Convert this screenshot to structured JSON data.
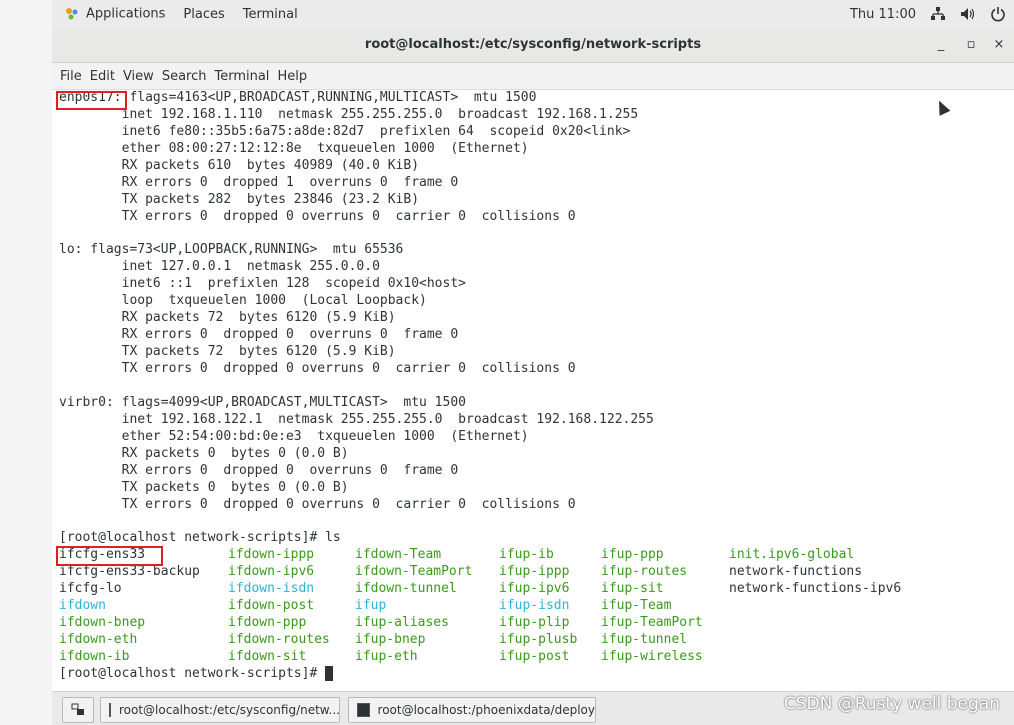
{
  "panel": {
    "applications": "Applications",
    "places": "Places",
    "terminal": "Terminal",
    "clock": "Thu 11:00",
    "icons": [
      "network-icon",
      "volume-icon",
      "power-icon"
    ]
  },
  "window": {
    "title": "root@localhost:/etc/sysconfig/network-scripts",
    "minimize": "_",
    "maximize": "▫",
    "close": "×"
  },
  "menu": [
    "File",
    "Edit",
    "View",
    "Search",
    "Terminal",
    "Help"
  ],
  "terminal_lines": [
    "enp0s17: flags=4163<UP,BROADCAST,RUNNING,MULTICAST>  mtu 1500",
    "        inet 192.168.1.110  netmask 255.255.255.0  broadcast 192.168.1.255",
    "        inet6 fe80::35b5:6a75:a8de:82d7  prefixlen 64  scopeid 0x20<link>",
    "        ether 08:00:27:12:12:8e  txqueuelen 1000  (Ethernet)",
    "        RX packets 610  bytes 40989 (40.0 KiB)",
    "        RX errors 0  dropped 1  overruns 0  frame 0",
    "        TX packets 282  bytes 23846 (23.2 KiB)",
    "        TX errors 0  dropped 0 overruns 0  carrier 0  collisions 0",
    "",
    "lo: flags=73<UP,LOOPBACK,RUNNING>  mtu 65536",
    "        inet 127.0.0.1  netmask 255.0.0.0",
    "        inet6 ::1  prefixlen 128  scopeid 0x10<host>",
    "        loop  txqueuelen 1000  (Local Loopback)",
    "        RX packets 72  bytes 6120 (5.9 KiB)",
    "        RX errors 0  dropped 0  overruns 0  frame 0",
    "        TX packets 72  bytes 6120 (5.9 KiB)",
    "        TX errors 0  dropped 0 overruns 0  carrier 0  collisions 0",
    "",
    "virbr0: flags=4099<UP,BROADCAST,MULTICAST>  mtu 1500",
    "        inet 192.168.122.1  netmask 255.255.255.0  broadcast 192.168.122.255",
    "        ether 52:54:00:bd:0e:e3  txqueuelen 1000  (Ethernet)",
    "        RX packets 0  bytes 0 (0.0 B)",
    "        RX errors 0  dropped 0  overruns 0  frame 0",
    "        TX packets 0  bytes 0 (0.0 B)",
    "        TX errors 0  dropped 0 overruns 0  carrier 0  collisions 0",
    "",
    "[root@localhost network-scripts]# ls"
  ],
  "ls_rows": [
    [
      [
        "ifcfg-ens33",
        "d"
      ],
      [
        "ifdown-ippp",
        "g"
      ],
      [
        "ifdown-Team",
        "g"
      ],
      [
        "ifup-ib",
        "g"
      ],
      [
        "ifup-ppp",
        "g"
      ],
      [
        "init.ipv6-global",
        "g"
      ]
    ],
    [
      [
        "ifcfg-ens33-backup",
        "d"
      ],
      [
        "ifdown-ipv6",
        "g"
      ],
      [
        "ifdown-TeamPort",
        "g"
      ],
      [
        "ifup-ippp",
        "g"
      ],
      [
        "ifup-routes",
        "g"
      ],
      [
        "network-functions",
        "d"
      ]
    ],
    [
      [
        "ifcfg-lo",
        "d"
      ],
      [
        "ifdown-isdn",
        "cy"
      ],
      [
        "ifdown-tunnel",
        "g"
      ],
      [
        "ifup-ipv6",
        "g"
      ],
      [
        "ifup-sit",
        "g"
      ],
      [
        "network-functions-ipv6",
        "d"
      ]
    ],
    [
      [
        "ifdown",
        "cy"
      ],
      [
        "ifdown-post",
        "g"
      ],
      [
        "ifup",
        "cy"
      ],
      [
        "ifup-isdn",
        "cy"
      ],
      [
        "ifup-Team",
        "g"
      ],
      [
        "",
        ""
      ]
    ],
    [
      [
        "ifdown-bnep",
        "g"
      ],
      [
        "ifdown-ppp",
        "g"
      ],
      [
        "ifup-aliases",
        "g"
      ],
      [
        "ifup-plip",
        "g"
      ],
      [
        "ifup-TeamPort",
        "g"
      ],
      [
        "",
        ""
      ]
    ],
    [
      [
        "ifdown-eth",
        "g"
      ],
      [
        "ifdown-routes",
        "g"
      ],
      [
        "ifup-bnep",
        "g"
      ],
      [
        "ifup-plusb",
        "g"
      ],
      [
        "ifup-tunnel",
        "g"
      ],
      [
        "",
        ""
      ]
    ],
    [
      [
        "ifdown-ib",
        "g"
      ],
      [
        "ifdown-sit",
        "g"
      ],
      [
        "ifup-eth",
        "g"
      ],
      [
        "ifup-post",
        "g"
      ],
      [
        "ifup-wireless",
        "g"
      ],
      [
        "",
        ""
      ]
    ]
  ],
  "final_prompt": "[root@localhost network-scripts]# ",
  "taskbar": {
    "task1": "root@localhost:/etc/sysconfig/netw...",
    "task2": "root@localhost:/phoenixdata/deploy"
  },
  "watermark": "CSDN @Rusty well began",
  "colors": {
    "green": "#3a9a1a",
    "cyan": "#2ab4d8",
    "highlight": "#e02020"
  }
}
